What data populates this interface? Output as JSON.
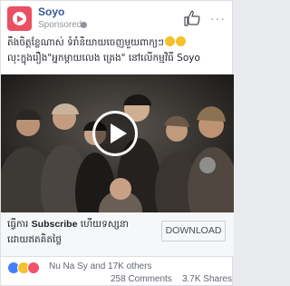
{
  "post": {
    "page_name": "Soyo",
    "sponsored": "Sponsored",
    "caption_line1": "តឹងចិត្តខ្លែណាស់ ទំរាំនិយាយចេញមួយពាក្យៗ",
    "caption_line2": "លុះក្នុងរឿង\"អ្នកម្តាយលេង ត្រេង\" នៅលើកម្មវិធី Soyo",
    "more": "···"
  },
  "cta": {
    "prefix": "ធ្វើការ ",
    "bold": "Subscribe",
    "suffix": " ហើយទស្សនា",
    "line2": "ដោយឥតគិតថ្លៃ",
    "button_label": "DOWNLOAD"
  },
  "engagement": {
    "reactors": "Nu Na Sy and 17K others",
    "comments": "258 Comments",
    "shares": "3.7K Shares"
  },
  "colors": {
    "brand": "#ea4f63",
    "link": "#365899",
    "like": "#4080ff",
    "haha": "#f7c12b",
    "love": "#f25268"
  }
}
